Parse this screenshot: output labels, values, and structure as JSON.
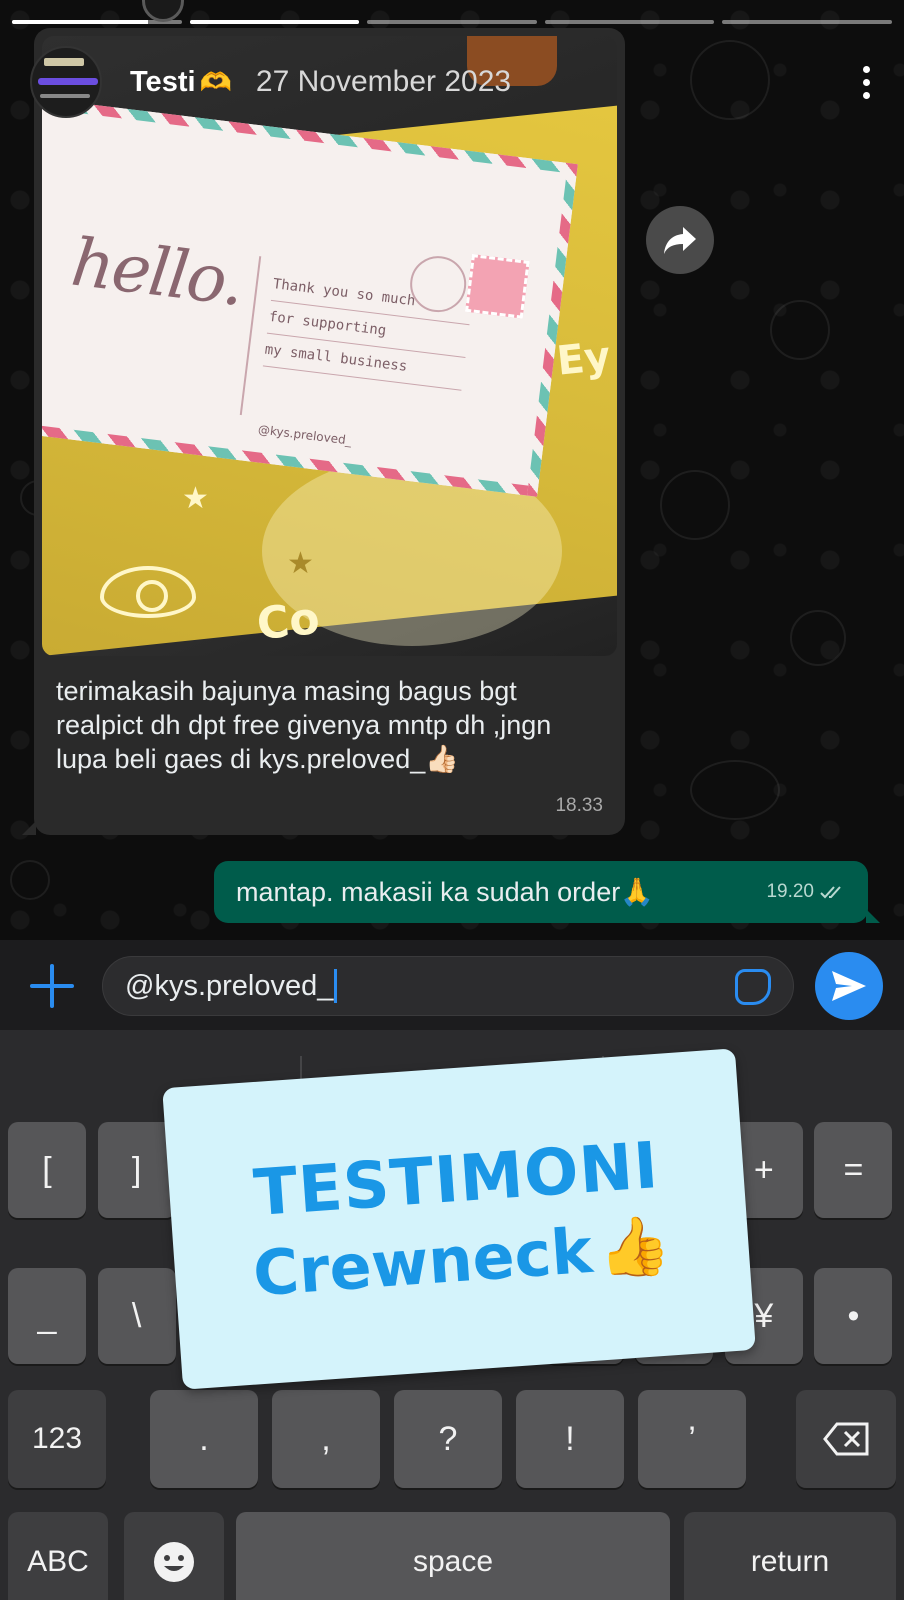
{
  "story": {
    "progress_segments": [
      1,
      1,
      0,
      0,
      0
    ],
    "active_segment_fill": 0.8,
    "name": "Testi",
    "name_emoji": "🫶",
    "date": "27 November 2023"
  },
  "incoming": {
    "text": "terimakasih bajunya masing bagus bgt realpict dh dpt free givenya mntp dh ,jngn lupa beli gaes di kys.preloved_👍🏻",
    "time": "18.33",
    "photo": {
      "card_hello": "hello.",
      "card_lines": [
        "Thank you so much",
        "for supporting",
        "my small business"
      ],
      "card_handle": "@kys.preloved_",
      "packet_text_eye": "Ey",
      "packet_text_bottom": "Co"
    }
  },
  "outgoing": {
    "text": "mantap. makasii ka sudah order🙏",
    "time": "19.20",
    "status_icon": "double-check-icon"
  },
  "input": {
    "value": "@kys.preloved_"
  },
  "keyboard": {
    "row1": [
      "[",
      "]",
      "{",
      "}",
      "#",
      "%",
      "^",
      "*",
      "+",
      "="
    ],
    "row2": [
      "_",
      "\\",
      "|",
      "~",
      "<",
      ">",
      "€",
      "£",
      "¥",
      "•"
    ],
    "row3_left": "123",
    "row3": [
      ".",
      ",",
      "?",
      "!",
      "’"
    ],
    "abc": "ABC",
    "space": "space",
    "return": "return"
  },
  "sticker": {
    "line1": "TESTIMONI",
    "line2": "Crewneck",
    "emoji": "👍"
  },
  "colors": {
    "accent_blue": "#2a8cf0",
    "outgoing_bubble": "#005c4b",
    "incoming_bubble": "#2a2a2a",
    "sticker_bg": "#d4f3fb",
    "sticker_text": "#1a97e6"
  }
}
